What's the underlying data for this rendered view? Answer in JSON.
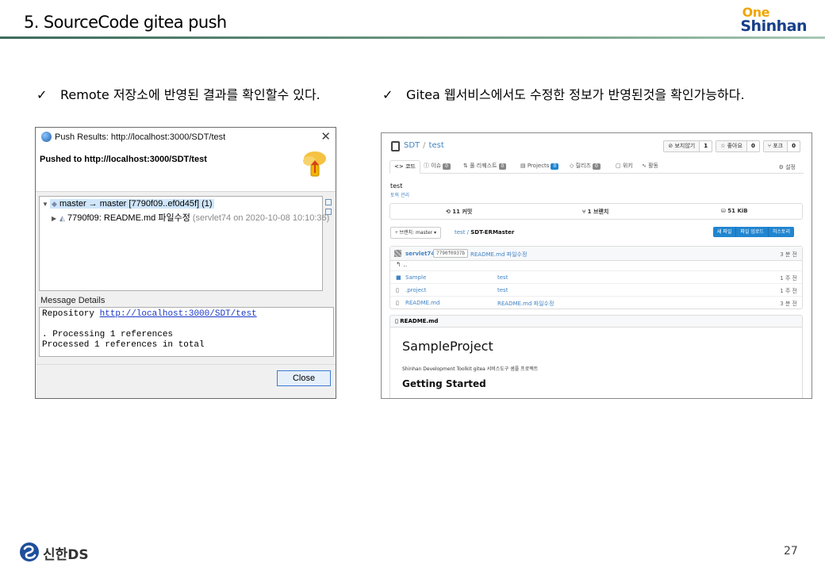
{
  "slide": {
    "title": "5. SourceCode gitea push",
    "logo_one": "One",
    "logo_shinhan": "Shinhan",
    "bullet_left": "Remote 저장소에 반영된 결과를 확인할수 있다.",
    "bullet_right": "Gitea 웹서비스에서도 수정한 정보가 반영된것을 확인가능하다.",
    "check_mark": "✓",
    "footer_brand": "신한DS",
    "page_number": "27"
  },
  "dialog": {
    "title": "Push Results: http://localhost:3000/SDT/test",
    "close_glyph": "✕",
    "heading": "Pushed to http://localhost:3000/SDT/test",
    "tree": {
      "ref_row": "master → master [7790f09..ef0d45f] (1)",
      "commit_row": "7790f09: README.md 파일수정",
      "commit_meta": "(servlet74 on 2020-10-08 10:10:36)"
    },
    "message_label": "Message Details",
    "message": {
      "repo_prefix": "Repository ",
      "repo_url": "http://localhost:3000/SDT/test",
      "line2": ". Processing 1 references",
      "line3": "Processed 1 references in total"
    },
    "close_button": "Close"
  },
  "gitea": {
    "breadcrumb": {
      "owner": "SDT",
      "sep": "/",
      "repo": "test"
    },
    "stats": [
      {
        "label": "⊘ 보지않기",
        "count": "1"
      },
      {
        "label": "☆ 좋아요",
        "count": "0"
      },
      {
        "label": "⑂ 포크",
        "count": "0"
      }
    ],
    "tabs": [
      {
        "label": "<> 코드",
        "badge": ""
      },
      {
        "label": "ⓘ 이슈",
        "badge": "0"
      },
      {
        "label": "⇅ 풀 리퀘스트",
        "badge": "0"
      },
      {
        "label": "▤ Projects",
        "badge": "0"
      },
      {
        "label": "◇ 릴리즈",
        "badge": "0"
      },
      {
        "label": "▢ 위키",
        "badge": ""
      },
      {
        "label": "∿ 활동",
        "badge": ""
      }
    ],
    "settings": "⚙ 설정",
    "description": "test",
    "topics": "토픽 관리",
    "summary": {
      "commits": "⟲ 11 커밋",
      "branches": "⑂ 1 브랜치",
      "size": "⛁ 51 KiB"
    },
    "branch_button": "⑂ 브랜치: master ▾",
    "path": {
      "repo": "test",
      "sep": " / ",
      "dir": "SDT-ERMaster"
    },
    "actions": [
      "새 파일",
      "파일 업로드",
      "히스토리"
    ],
    "last_commit": {
      "author": "servlet74",
      "sha": "7790f0937b",
      "message": "README.md 파일수정",
      "time": "3 분 전"
    },
    "back_glyph": "↰ ..",
    "files": [
      {
        "type": "folder",
        "icon": "■",
        "name": "Sample",
        "message": "test",
        "time": "1 주 전"
      },
      {
        "type": "file",
        "icon": "▯",
        "name": ".project",
        "message": "test",
        "time": "1 주 전"
      },
      {
        "type": "file",
        "icon": "▯",
        "name": "README.md",
        "message": "README.md 파일수정",
        "time": "3 분 전"
      }
    ],
    "readme_label": "▯ README.md",
    "readme": {
      "h1": "SampleProject",
      "p": "Shinhan Development Toolkit gitea 서비스도구 샘플 프로젝트",
      "h2": "Getting Started"
    }
  },
  "colors": {
    "accent_green": "#3d6b5c",
    "brand_blue": "#173f8a",
    "brand_gold": "#f0a500",
    "link_blue": "#4183c4",
    "button_blue": "#2185d0"
  }
}
